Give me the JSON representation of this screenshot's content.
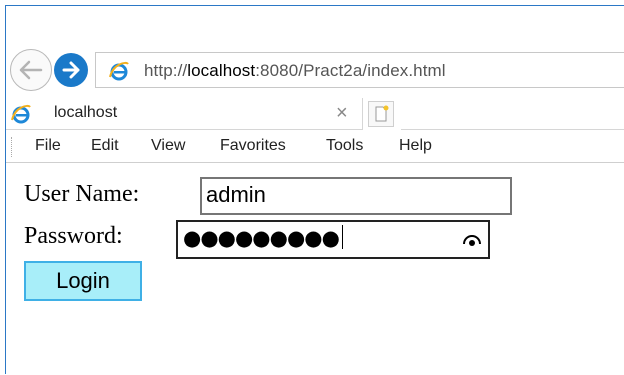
{
  "browser": {
    "url_prefix": "http://",
    "url_host": "localhost",
    "url_rest": ":8080/Pract2a/index.html",
    "tab_title": "localhost",
    "tab_close": "×",
    "accent_color": "#1a79c9"
  },
  "menu": {
    "items": [
      "File",
      "Edit",
      "View",
      "Favorites",
      "Tools",
      "Help"
    ]
  },
  "form": {
    "username_label": "User Name:",
    "username_value": "admin",
    "password_label": "Password:",
    "password_masked": "●●●●●●●●●",
    "login_label": "Login"
  }
}
